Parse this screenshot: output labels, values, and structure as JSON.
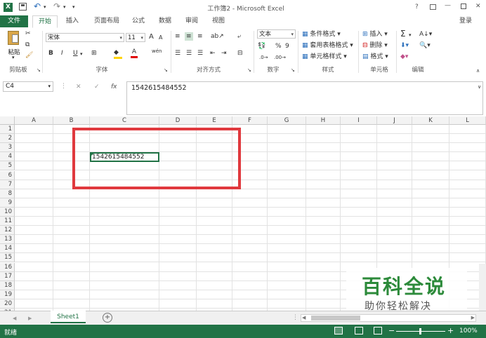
{
  "titlebar": {
    "title": "工作簿2 - Microsoft Excel",
    "help": "?",
    "minimize": "—",
    "close": "✕",
    "excel_logo": "X"
  },
  "tabs": [
    "文件",
    "开始",
    "插入",
    "页面布局",
    "公式",
    "数据",
    "审阅",
    "视图"
  ],
  "login": "登录",
  "ribbon": {
    "clipboard": {
      "paste": "粘贴",
      "label": "剪贴板"
    },
    "font": {
      "name": "宋体",
      "size": "11",
      "label": "字体",
      "bold": "B",
      "italic": "I",
      "underline": "U",
      "grow": "A",
      "shrink": "A",
      "color": "A",
      "wen": "wén"
    },
    "alignment": {
      "label": "对齐方式"
    },
    "number": {
      "format": "文本",
      "percent": "%",
      "comma": "9",
      "label": "数字"
    },
    "styles": {
      "conditional": "条件格式",
      "table": "套用表格格式",
      "cell": "单元格样式",
      "label": "样式"
    },
    "cells": {
      "insert": "插入",
      "delete": "删除",
      "format": "格式",
      "label": "单元格"
    },
    "editing": {
      "sum": "Σ",
      "label": "编辑"
    }
  },
  "formula_bar": {
    "name_box": "C4",
    "fx": "fx",
    "cancel": "✕",
    "enter": "✓",
    "content": "1542615484552"
  },
  "grid": {
    "columns": [
      "A",
      "B",
      "C",
      "D",
      "E",
      "F",
      "G",
      "H",
      "I",
      "J",
      "K",
      "L"
    ],
    "rows": [
      "1",
      "2",
      "3",
      "4",
      "5",
      "6",
      "7",
      "8",
      "9",
      "10",
      "11",
      "12",
      "13",
      "14",
      "15",
      "16",
      "17",
      "18",
      "19",
      "20",
      "21"
    ],
    "cell_value": "1542615484552"
  },
  "sheets": {
    "active": "Sheet1",
    "add": "+"
  },
  "status": {
    "ready": "就绪",
    "zoom": "100%",
    "minus": "−",
    "plus": "+"
  },
  "watermark": {
    "title": "百科全说",
    "subtitle": "助你轻松解决"
  },
  "colors": {
    "excel_green": "#217346",
    "highlight_red": "#e0393e"
  }
}
